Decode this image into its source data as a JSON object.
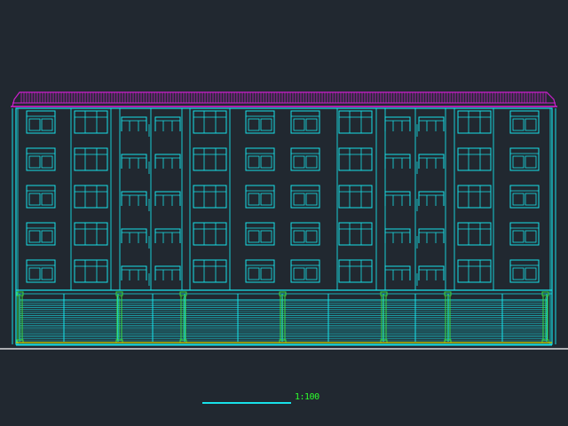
{
  "drawing": {
    "scale_text": "1:100",
    "colors": {
      "background": "#212830",
      "outline": "#18e0e8",
      "roof": "#cc1fcc",
      "column": "#3cd83c",
      "base": "#d8d800",
      "ground": "#ffffff",
      "scale_line": "#18e0e8",
      "scale_text": "#2cff2c"
    },
    "elevation": {
      "floors_upper": 5,
      "shopfront_bays": 10,
      "window_columns": 12,
      "columns": 7
    }
  }
}
